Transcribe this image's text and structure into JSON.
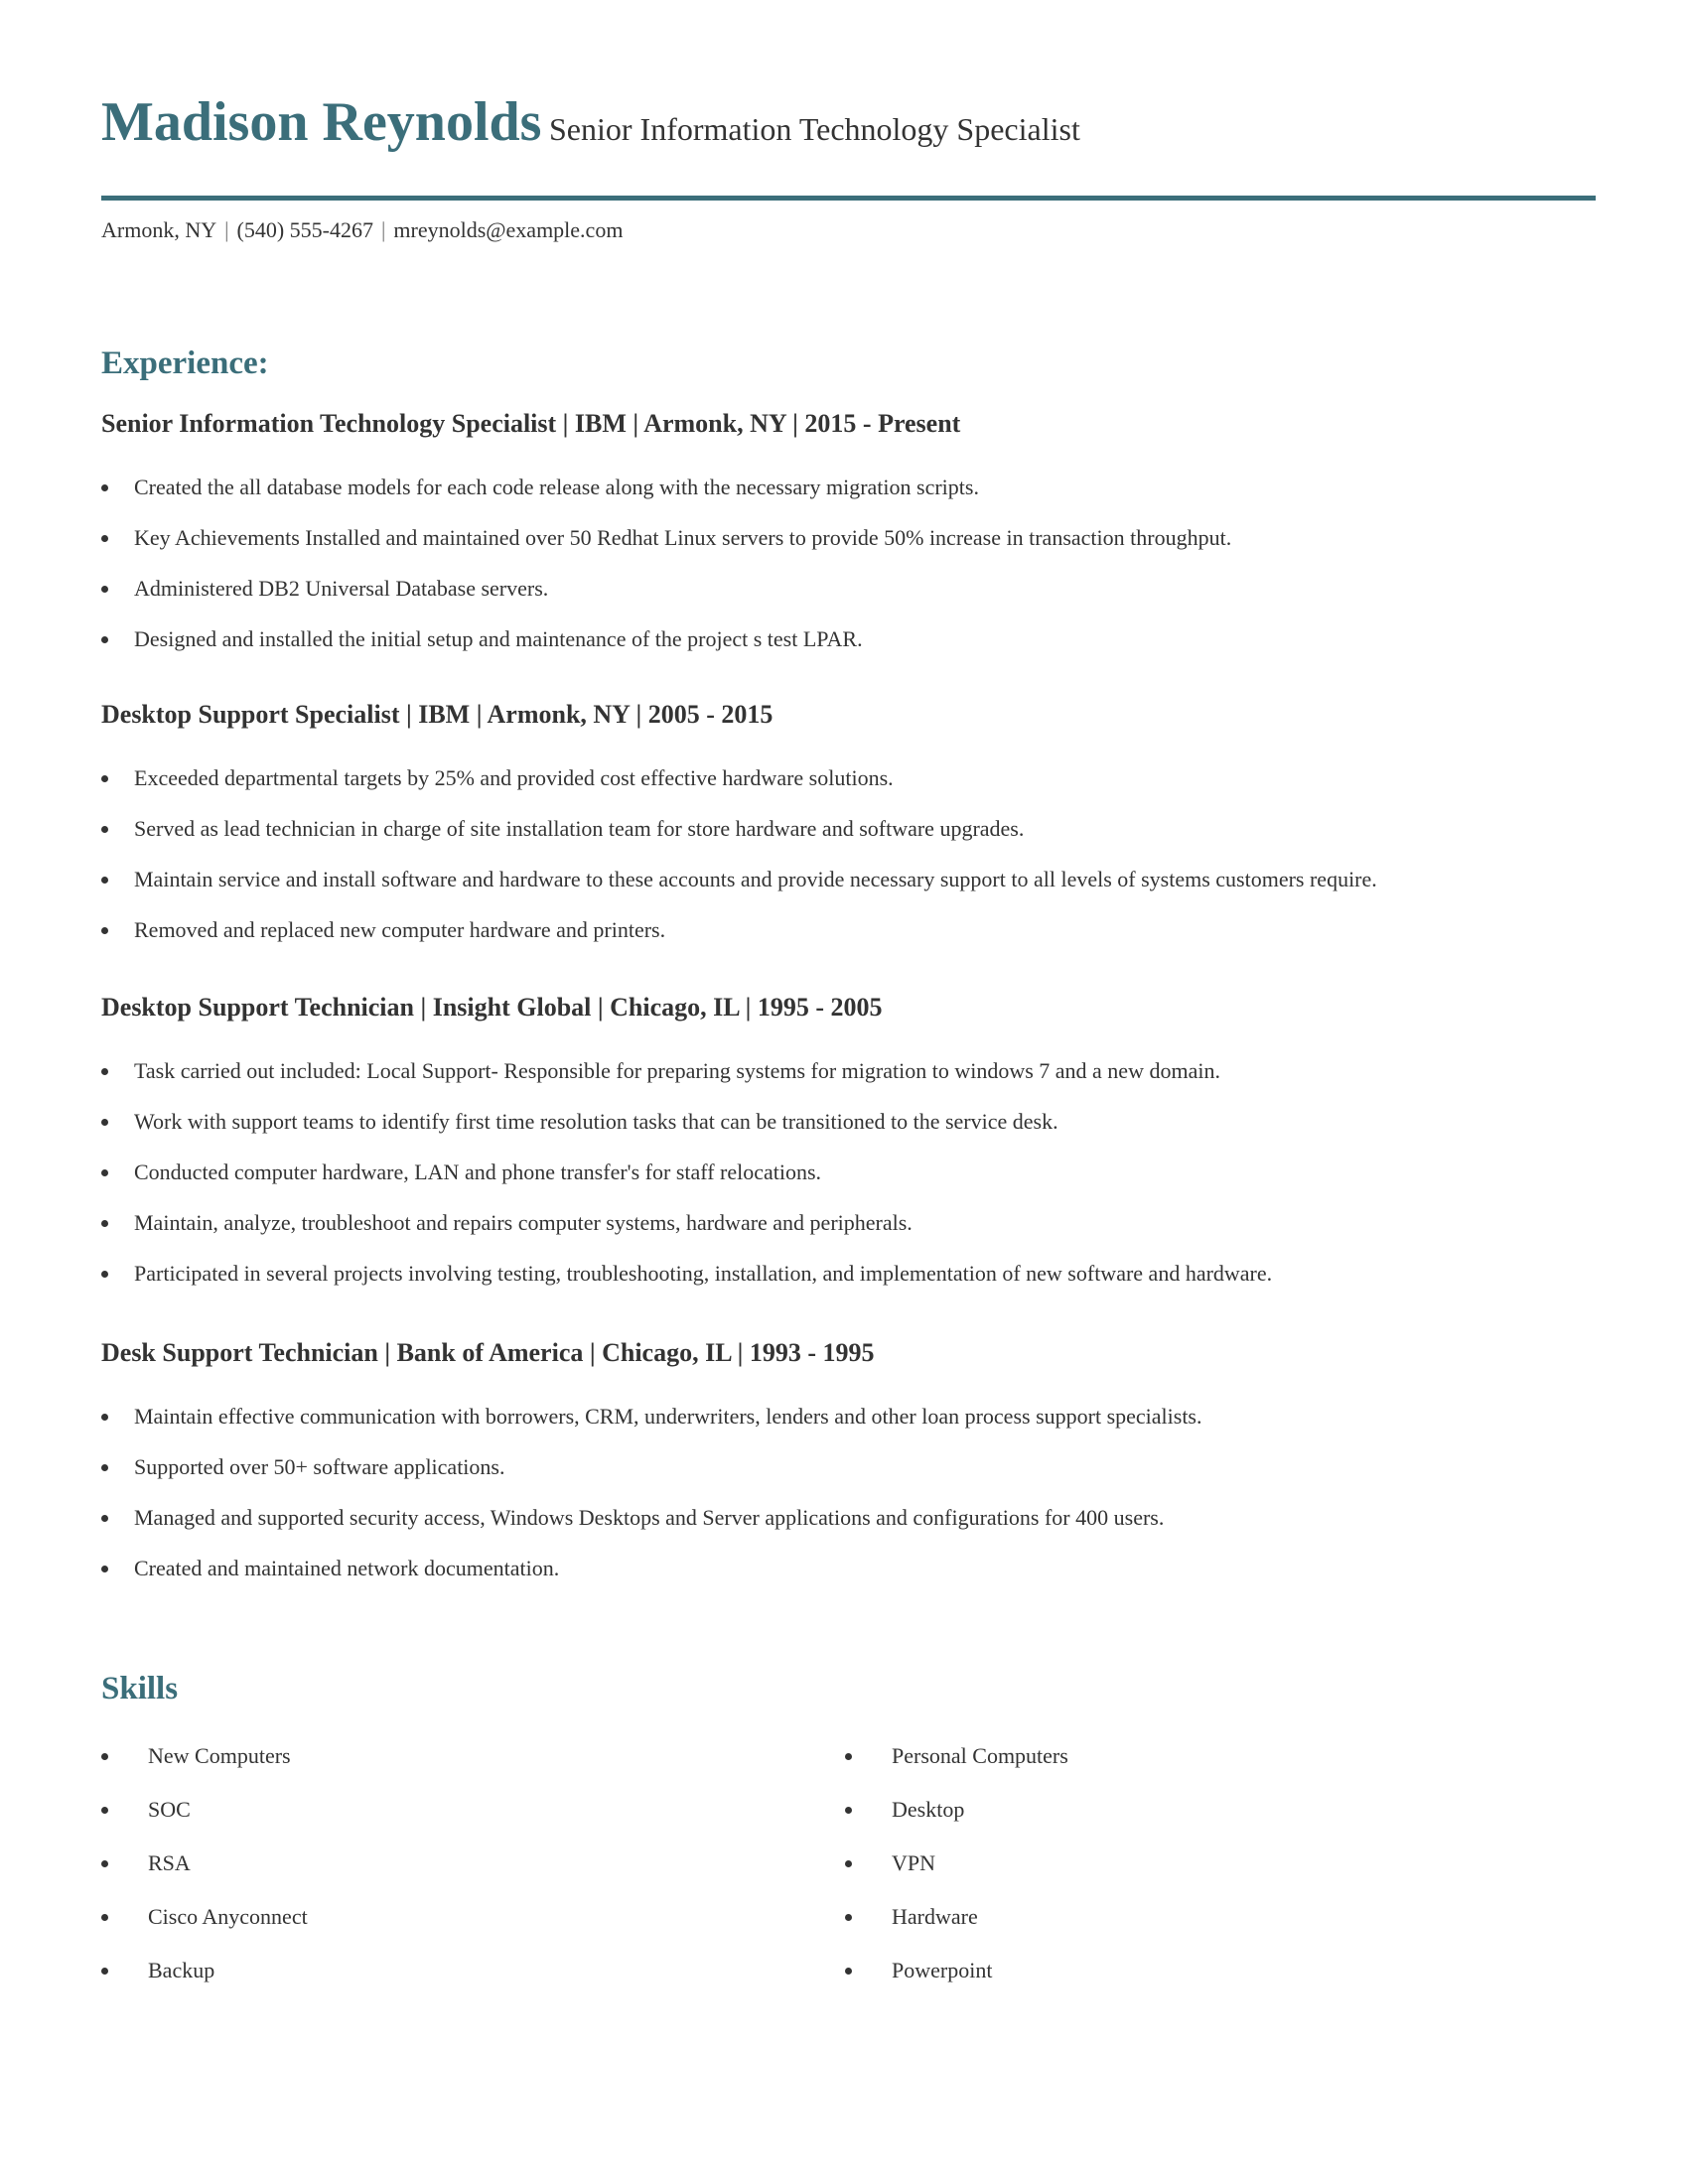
{
  "header": {
    "name": "Madison Reynolds",
    "title": "Senior Information Technology Specialist",
    "accent_color": "#3b6e7a"
  },
  "contact": {
    "location": "Armonk, NY",
    "phone": "(540) 555-4267",
    "email": "mreynolds@example.com",
    "separator": "|"
  },
  "experience": {
    "heading": "Experience:",
    "jobs": [
      {
        "title": "Senior Information Technology Specialist | IBM | Armonk, NY |  2015 - Present",
        "bullets": [
          "Created the all database models for each code release along with the necessary migration scripts.",
          "Key Achievements Installed and maintained over 50 Redhat Linux servers to provide 50% increase in transaction throughput.",
          "Administered DB2 Universal Database servers.",
          "Designed and installed the initial setup and maintenance of the project s test LPAR."
        ]
      },
      {
        "title": "Desktop Support Specialist | IBM | Armonk, NY |  2005 - 2015",
        "bullets": [
          "Exceeded departmental targets by 25% and provided cost effective hardware solutions.",
          "Served as lead technician in charge of site installation team for store hardware and software upgrades.",
          "Maintain service and install software and hardware to these accounts and provide necessary support to all levels of systems customers require.",
          "Removed and replaced new computer hardware and printers."
        ]
      },
      {
        "title": "Desktop Support Technician | Insight Global | Chicago, IL |  1995 - 2005",
        "bullets": [
          "Task carried out included: Local Support- Responsible for preparing systems for migration to windows 7 and a new domain.",
          "Work with support teams to identify first time resolution tasks that can be transitioned to the service desk.",
          "Conducted computer hardware, LAN and phone transfer's for staff relocations.",
          "Maintain, analyze, troubleshoot and repairs computer systems, hardware and peripherals.",
          "Participated in several projects involving testing, troubleshooting, installation, and implementation of new software and hardware."
        ]
      },
      {
        "title": "Desk Support Technician | Bank of America | Chicago, IL |  1993 - 1995",
        "bullets": [
          "Maintain effective communication with borrowers, CRM, underwriters, lenders and other loan process support specialists.",
          "Supported over 50+ software applications.",
          "Managed and supported security access, Windows Desktops and Server applications and configurations for 400 users.",
          "Created and maintained network documentation."
        ]
      }
    ]
  },
  "skills": {
    "heading": "Skills",
    "left": [
      "New Computers",
      "SOC",
      "RSA",
      "Cisco Anyconnect",
      "Backup"
    ],
    "right": [
      "Personal Computers",
      "Desktop",
      "VPN",
      "Hardware",
      "Powerpoint"
    ]
  }
}
